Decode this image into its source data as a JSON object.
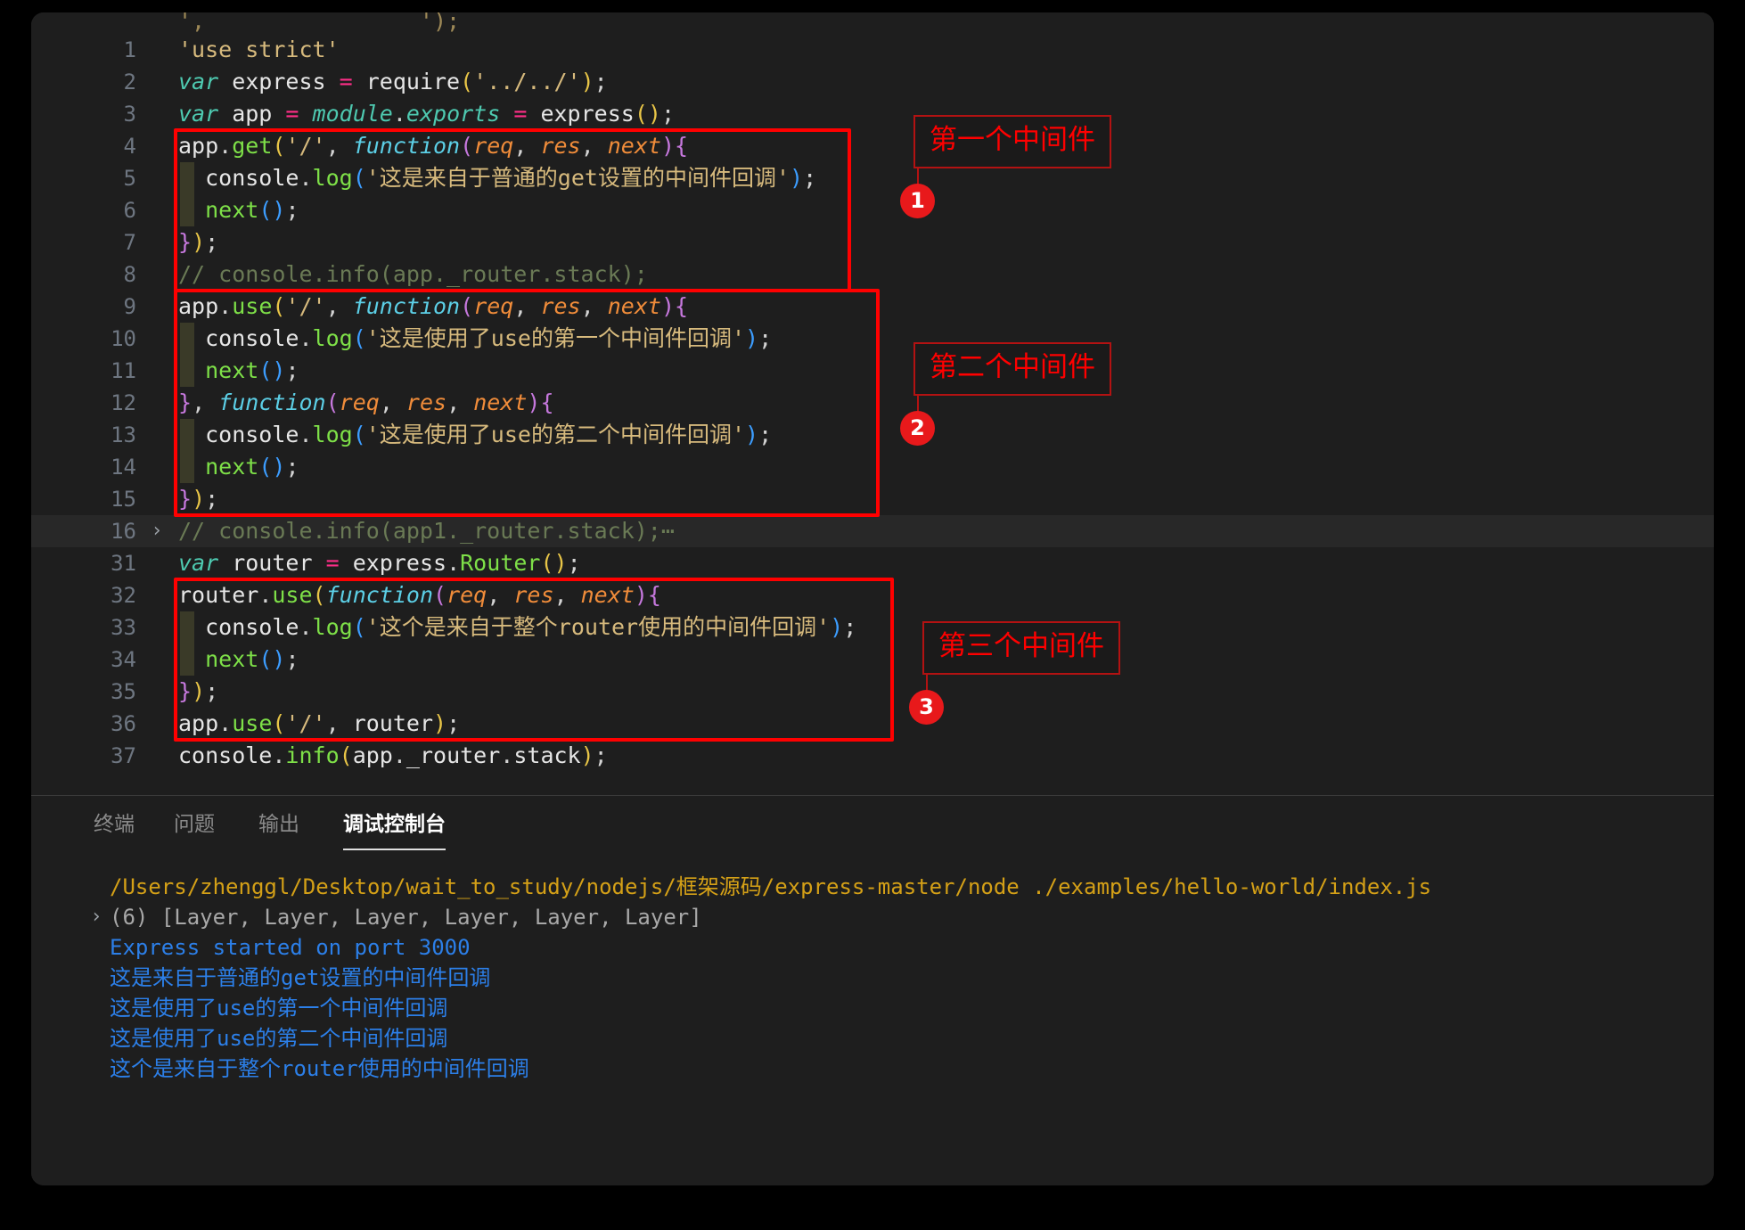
{
  "window": {
    "background_color": "#1e1e1e",
    "page_background": "#000000"
  },
  "editor": {
    "partial_top_line": "',                ');",
    "lines": [
      {
        "num": "1",
        "indent": 0,
        "guide": false,
        "fold": "",
        "highlight": false,
        "tokens": [
          {
            "t": "'use strict'",
            "c": "t-str2"
          }
        ]
      },
      {
        "num": "2",
        "indent": 0,
        "guide": false,
        "fold": "",
        "highlight": false,
        "tokens": [
          {
            "t": "var",
            "c": "t-kw"
          },
          {
            "t": " express ",
            "c": "t-plain"
          },
          {
            "t": "=",
            "c": "t-op"
          },
          {
            "t": " require",
            "c": "t-plain"
          },
          {
            "t": "(",
            "c": "t-paren1"
          },
          {
            "t": "'../../'",
            "c": "t-str2"
          },
          {
            "t": ")",
            "c": "t-paren1"
          },
          {
            "t": ";",
            "c": "t-punc"
          }
        ]
      },
      {
        "num": "3",
        "indent": 0,
        "guide": false,
        "fold": "",
        "highlight": false,
        "tokens": [
          {
            "t": "var",
            "c": "t-kw"
          },
          {
            "t": " app ",
            "c": "t-plain"
          },
          {
            "t": "=",
            "c": "t-op"
          },
          {
            "t": " ",
            "c": "t-plain"
          },
          {
            "t": "module",
            "c": "t-kw"
          },
          {
            "t": ".",
            "c": "t-punc"
          },
          {
            "t": "exports",
            "c": "t-kw"
          },
          {
            "t": " ",
            "c": "t-plain"
          },
          {
            "t": "=",
            "c": "t-op"
          },
          {
            "t": " express",
            "c": "t-plain"
          },
          {
            "t": "(",
            "c": "t-paren1"
          },
          {
            "t": ")",
            "c": "t-paren1"
          },
          {
            "t": ";",
            "c": "t-punc"
          }
        ]
      },
      {
        "num": "4",
        "indent": 0,
        "guide": false,
        "fold": "",
        "highlight": false,
        "tokens": [
          {
            "t": "app",
            "c": "t-plain"
          },
          {
            "t": ".",
            "c": "t-punc"
          },
          {
            "t": "get",
            "c": "t-method"
          },
          {
            "t": "(",
            "c": "t-paren1"
          },
          {
            "t": "'/'",
            "c": "t-str2"
          },
          {
            "t": ", ",
            "c": "t-punc"
          },
          {
            "t": "function",
            "c": "t-fnB"
          },
          {
            "t": "(",
            "c": "t-paren2"
          },
          {
            "t": "req",
            "c": "t-param"
          },
          {
            "t": ", ",
            "c": "t-punc"
          },
          {
            "t": "res",
            "c": "t-param"
          },
          {
            "t": ", ",
            "c": "t-punc"
          },
          {
            "t": "next",
            "c": "t-param"
          },
          {
            "t": ")",
            "c": "t-paren2"
          },
          {
            "t": "{",
            "c": "t-brace"
          }
        ]
      },
      {
        "num": "5",
        "indent": 1,
        "guide": true,
        "fold": "",
        "highlight": false,
        "tokens": [
          {
            "t": "  console",
            "c": "t-plain"
          },
          {
            "t": ".",
            "c": "t-punc"
          },
          {
            "t": "log",
            "c": "t-method"
          },
          {
            "t": "(",
            "c": "t-paren3"
          },
          {
            "t": "'这是来自于普通的get设置的中间件回调'",
            "c": "t-str2"
          },
          {
            "t": ")",
            "c": "t-paren3"
          },
          {
            "t": ";",
            "c": "t-punc"
          }
        ]
      },
      {
        "num": "6",
        "indent": 1,
        "guide": true,
        "fold": "",
        "highlight": false,
        "tokens": [
          {
            "t": "  next",
            "c": "t-fn"
          },
          {
            "t": "(",
            "c": "t-paren3"
          },
          {
            "t": ")",
            "c": "t-paren3"
          },
          {
            "t": ";",
            "c": "t-punc"
          }
        ]
      },
      {
        "num": "7",
        "indent": 0,
        "guide": false,
        "fold": "",
        "highlight": false,
        "tokens": [
          {
            "t": "}",
            "c": "t-brace"
          },
          {
            "t": ")",
            "c": "t-paren1"
          },
          {
            "t": ";",
            "c": "t-punc"
          }
        ]
      },
      {
        "num": "8",
        "indent": 0,
        "guide": false,
        "fold": "",
        "highlight": false,
        "tokens": [
          {
            "t": "// console.info(app._router.stack);",
            "c": "t-comment"
          }
        ]
      },
      {
        "num": "9",
        "indent": 0,
        "guide": false,
        "fold": "",
        "highlight": false,
        "tokens": [
          {
            "t": "app",
            "c": "t-plain"
          },
          {
            "t": ".",
            "c": "t-punc"
          },
          {
            "t": "use",
            "c": "t-method"
          },
          {
            "t": "(",
            "c": "t-paren1"
          },
          {
            "t": "'/'",
            "c": "t-str2"
          },
          {
            "t": ", ",
            "c": "t-punc"
          },
          {
            "t": "function",
            "c": "t-fnB"
          },
          {
            "t": "(",
            "c": "t-paren2"
          },
          {
            "t": "req",
            "c": "t-param"
          },
          {
            "t": ", ",
            "c": "t-punc"
          },
          {
            "t": "res",
            "c": "t-param"
          },
          {
            "t": ", ",
            "c": "t-punc"
          },
          {
            "t": "next",
            "c": "t-param"
          },
          {
            "t": ")",
            "c": "t-paren2"
          },
          {
            "t": "{",
            "c": "t-brace"
          }
        ]
      },
      {
        "num": "10",
        "indent": 1,
        "guide": true,
        "fold": "",
        "highlight": false,
        "tokens": [
          {
            "t": "  console",
            "c": "t-plain"
          },
          {
            "t": ".",
            "c": "t-punc"
          },
          {
            "t": "log",
            "c": "t-method"
          },
          {
            "t": "(",
            "c": "t-paren3"
          },
          {
            "t": "'这是使用了use的第一个中间件回调'",
            "c": "t-str2"
          },
          {
            "t": ")",
            "c": "t-paren3"
          },
          {
            "t": ";",
            "c": "t-punc"
          }
        ]
      },
      {
        "num": "11",
        "indent": 1,
        "guide": true,
        "fold": "",
        "highlight": false,
        "tokens": [
          {
            "t": "  next",
            "c": "t-fn"
          },
          {
            "t": "(",
            "c": "t-paren3"
          },
          {
            "t": ")",
            "c": "t-paren3"
          },
          {
            "t": ";",
            "c": "t-punc"
          }
        ]
      },
      {
        "num": "12",
        "indent": 0,
        "guide": false,
        "fold": "",
        "highlight": false,
        "tokens": [
          {
            "t": "}",
            "c": "t-brace"
          },
          {
            "t": ", ",
            "c": "t-punc"
          },
          {
            "t": "function",
            "c": "t-fnB"
          },
          {
            "t": "(",
            "c": "t-paren2"
          },
          {
            "t": "req",
            "c": "t-param"
          },
          {
            "t": ", ",
            "c": "t-punc"
          },
          {
            "t": "res",
            "c": "t-param"
          },
          {
            "t": ", ",
            "c": "t-punc"
          },
          {
            "t": "next",
            "c": "t-param"
          },
          {
            "t": ")",
            "c": "t-paren2"
          },
          {
            "t": "{",
            "c": "t-brace"
          }
        ]
      },
      {
        "num": "13",
        "indent": 1,
        "guide": true,
        "fold": "",
        "highlight": false,
        "tokens": [
          {
            "t": "  console",
            "c": "t-plain"
          },
          {
            "t": ".",
            "c": "t-punc"
          },
          {
            "t": "log",
            "c": "t-method"
          },
          {
            "t": "(",
            "c": "t-paren3"
          },
          {
            "t": "'这是使用了use的第二个中间件回调'",
            "c": "t-str2"
          },
          {
            "t": ")",
            "c": "t-paren3"
          },
          {
            "t": ";",
            "c": "t-punc"
          }
        ]
      },
      {
        "num": "14",
        "indent": 1,
        "guide": true,
        "fold": "",
        "highlight": false,
        "tokens": [
          {
            "t": "  next",
            "c": "t-fn"
          },
          {
            "t": "(",
            "c": "t-paren3"
          },
          {
            "t": ")",
            "c": "t-paren3"
          },
          {
            "t": ";",
            "c": "t-punc"
          }
        ]
      },
      {
        "num": "15",
        "indent": 0,
        "guide": false,
        "fold": "",
        "highlight": false,
        "tokens": [
          {
            "t": "}",
            "c": "t-brace"
          },
          {
            "t": ")",
            "c": "t-paren1"
          },
          {
            "t": ";",
            "c": "t-punc"
          }
        ]
      },
      {
        "num": "16",
        "indent": 0,
        "guide": false,
        "fold": "›",
        "highlight": true,
        "tokens": [
          {
            "t": "// console.info(app1._router.stack);⋯",
            "c": "t-comment"
          }
        ]
      },
      {
        "num": "31",
        "indent": 0,
        "guide": false,
        "fold": "",
        "highlight": false,
        "tokens": [
          {
            "t": "var",
            "c": "t-kw"
          },
          {
            "t": " router ",
            "c": "t-plain"
          },
          {
            "t": "=",
            "c": "t-op"
          },
          {
            "t": " express",
            "c": "t-plain"
          },
          {
            "t": ".",
            "c": "t-punc"
          },
          {
            "t": "Router",
            "c": "t-cls"
          },
          {
            "t": "(",
            "c": "t-paren1"
          },
          {
            "t": ")",
            "c": "t-paren1"
          },
          {
            "t": ";",
            "c": "t-punc"
          }
        ]
      },
      {
        "num": "32",
        "indent": 0,
        "guide": false,
        "fold": "",
        "highlight": false,
        "tokens": [
          {
            "t": "router",
            "c": "t-plain"
          },
          {
            "t": ".",
            "c": "t-punc"
          },
          {
            "t": "use",
            "c": "t-method"
          },
          {
            "t": "(",
            "c": "t-paren1"
          },
          {
            "t": "function",
            "c": "t-fnB"
          },
          {
            "t": "(",
            "c": "t-paren2"
          },
          {
            "t": "req",
            "c": "t-param"
          },
          {
            "t": ", ",
            "c": "t-punc"
          },
          {
            "t": "res",
            "c": "t-param"
          },
          {
            "t": ", ",
            "c": "t-punc"
          },
          {
            "t": "next",
            "c": "t-param"
          },
          {
            "t": ")",
            "c": "t-paren2"
          },
          {
            "t": "{",
            "c": "t-brace"
          }
        ]
      },
      {
        "num": "33",
        "indent": 1,
        "guide": true,
        "fold": "",
        "highlight": false,
        "tokens": [
          {
            "t": "  console",
            "c": "t-plain"
          },
          {
            "t": ".",
            "c": "t-punc"
          },
          {
            "t": "log",
            "c": "t-method"
          },
          {
            "t": "(",
            "c": "t-paren3"
          },
          {
            "t": "'这个是来自于整个router使用的中间件回调'",
            "c": "t-str2"
          },
          {
            "t": ")",
            "c": "t-paren3"
          },
          {
            "t": ";",
            "c": "t-punc"
          }
        ]
      },
      {
        "num": "34",
        "indent": 1,
        "guide": true,
        "fold": "",
        "highlight": false,
        "tokens": [
          {
            "t": "  next",
            "c": "t-fn"
          },
          {
            "t": "(",
            "c": "t-paren3"
          },
          {
            "t": ")",
            "c": "t-paren3"
          },
          {
            "t": ";",
            "c": "t-punc"
          }
        ]
      },
      {
        "num": "35",
        "indent": 0,
        "guide": false,
        "fold": "",
        "highlight": false,
        "tokens": [
          {
            "t": "}",
            "c": "t-brace"
          },
          {
            "t": ")",
            "c": "t-paren1"
          },
          {
            "t": ";",
            "c": "t-punc"
          }
        ]
      },
      {
        "num": "36",
        "indent": 0,
        "guide": false,
        "fold": "",
        "highlight": false,
        "tokens": [
          {
            "t": "app",
            "c": "t-plain"
          },
          {
            "t": ".",
            "c": "t-punc"
          },
          {
            "t": "use",
            "c": "t-method"
          },
          {
            "t": "(",
            "c": "t-paren1"
          },
          {
            "t": "'/'",
            "c": "t-str2"
          },
          {
            "t": ", ",
            "c": "t-punc"
          },
          {
            "t": "router",
            "c": "t-plain"
          },
          {
            "t": ")",
            "c": "t-paren1"
          },
          {
            "t": ";",
            "c": "t-punc"
          }
        ]
      },
      {
        "num": "37",
        "indent": 0,
        "guide": false,
        "fold": "",
        "highlight": false,
        "tokens": [
          {
            "t": "console",
            "c": "t-plain"
          },
          {
            "t": ".",
            "c": "t-punc"
          },
          {
            "t": "info",
            "c": "t-method"
          },
          {
            "t": "(",
            "c": "t-paren1"
          },
          {
            "t": "app",
            "c": "t-plain"
          },
          {
            "t": ".",
            "c": "t-punc"
          },
          {
            "t": "_router",
            "c": "t-plain"
          },
          {
            "t": ".",
            "c": "t-punc"
          },
          {
            "t": "stack",
            "c": "t-plain"
          },
          {
            "t": ")",
            "c": "t-paren1"
          },
          {
            "t": ";",
            "c": "t-punc"
          }
        ]
      }
    ]
  },
  "annotations": {
    "accent_color": "#ff0000",
    "badge_color": "#e8191b",
    "items": [
      {
        "badge": "1",
        "label": "第一个中间件"
      },
      {
        "badge": "2",
        "label": "第二个中间件"
      },
      {
        "badge": "3",
        "label": "第三个中间件"
      }
    ]
  },
  "panel": {
    "tabs": [
      {
        "label": "终端",
        "active": false
      },
      {
        "label": "问题",
        "active": false
      },
      {
        "label": "输出",
        "active": false
      },
      {
        "label": "调试控制台",
        "active": true
      }
    ],
    "console_lines": [
      {
        "text": "/Users/zhenggl/Desktop/wait_to_study/nodejs/框架源码/express-master/node ./examples/hello-world/index.js",
        "color": "c-yellow",
        "chevron": ""
      },
      {
        "text": "(6) [Layer, Layer, Layer, Layer, Layer, Layer]",
        "color": "c-grey",
        "chevron": "›"
      },
      {
        "text": "Express started on port 3000",
        "color": "c-blue",
        "chevron": ""
      },
      {
        "text": "这是来自于普通的get设置的中间件回调",
        "color": "c-blue",
        "chevron": ""
      },
      {
        "text": "这是使用了use的第一个中间件回调",
        "color": "c-blue",
        "chevron": ""
      },
      {
        "text": "这是使用了use的第二个中间件回调",
        "color": "c-blue",
        "chevron": ""
      },
      {
        "text": "这个是来自于整个router使用的中间件回调",
        "color": "c-blue",
        "chevron": ""
      }
    ]
  }
}
